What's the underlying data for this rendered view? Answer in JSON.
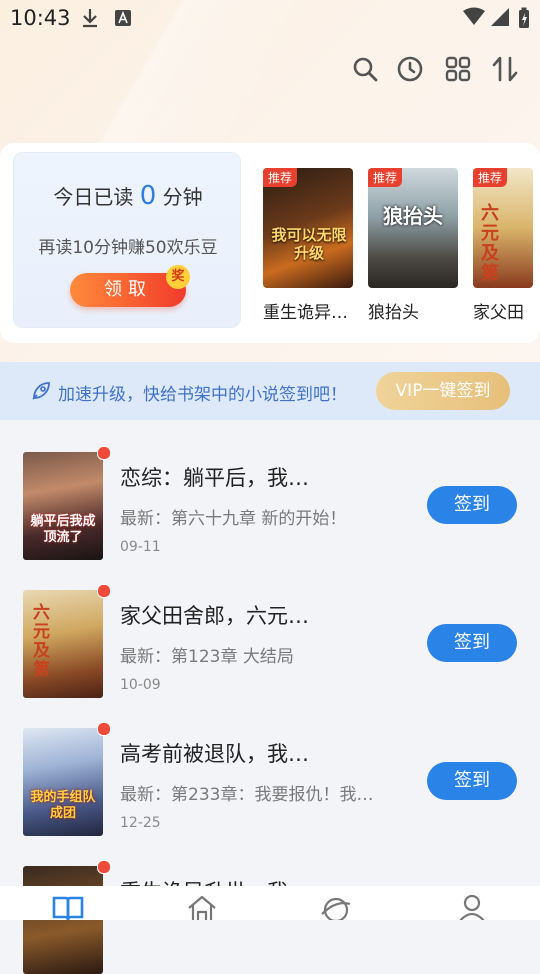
{
  "status_bar": {
    "time": "10:43"
  },
  "reading_card": {
    "prefix": "今日已读",
    "minutes": "0",
    "suffix": "分钟",
    "promo": "再读10分钟赚50欢乐豆",
    "claim_label": "领取",
    "badge": "奖"
  },
  "recommendations": [
    {
      "tag": "推荐",
      "title": "重生诡异…",
      "cover_text": "我可以无限升级"
    },
    {
      "tag": "推荐",
      "title": "狼抬头",
      "cover_text": "狼抬头"
    },
    {
      "tag": "推荐",
      "title": "家父田",
      "cover_text": "六元及第"
    }
  ],
  "banner": {
    "text": "加速升级，快给书架中的小说签到吧！",
    "vip_label": "VIP一键签到"
  },
  "books": [
    {
      "title": "恋综：躺平后，我…",
      "latest": "最新：第六十九章 新的开始！",
      "date": "09-11",
      "action": "签到",
      "cover_text": "躺平后我成顶流了"
    },
    {
      "title": "家父田舍郎，六元…",
      "latest": "最新：第123章 大结局",
      "date": "10-09",
      "action": "签到",
      "cover_text": "六元及第"
    },
    {
      "title": "高考前被退队，我…",
      "latest": "最新：第233章：我要报仇！我…",
      "date": "12-25",
      "action": "签到",
      "cover_text": "我的手组队成团"
    },
    {
      "title": "重生诡异升世，我…",
      "latest": "",
      "date": "",
      "action": "",
      "cover_text": ""
    }
  ],
  "colors": {
    "accent": "#2a83e6",
    "red": "#e8402e"
  }
}
